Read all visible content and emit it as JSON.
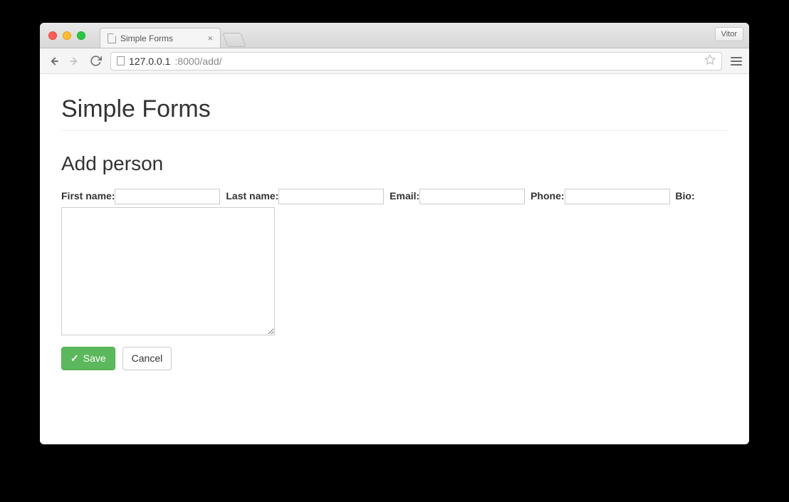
{
  "browser": {
    "tab_title": "Simple Forms",
    "user_badge": "Vitor",
    "url_host": "127.0.0.1",
    "url_port_path": ":8000/add/"
  },
  "page": {
    "title": "Simple Forms",
    "section_title": "Add person"
  },
  "form": {
    "first_name_label": "First name:",
    "last_name_label": "Last name:",
    "email_label": "Email:",
    "phone_label": "Phone:",
    "bio_label": "Bio:",
    "first_name_value": "",
    "last_name_value": "",
    "email_value": "",
    "phone_value": "",
    "bio_value": ""
  },
  "buttons": {
    "save_label": "Save",
    "cancel_label": "Cancel"
  }
}
